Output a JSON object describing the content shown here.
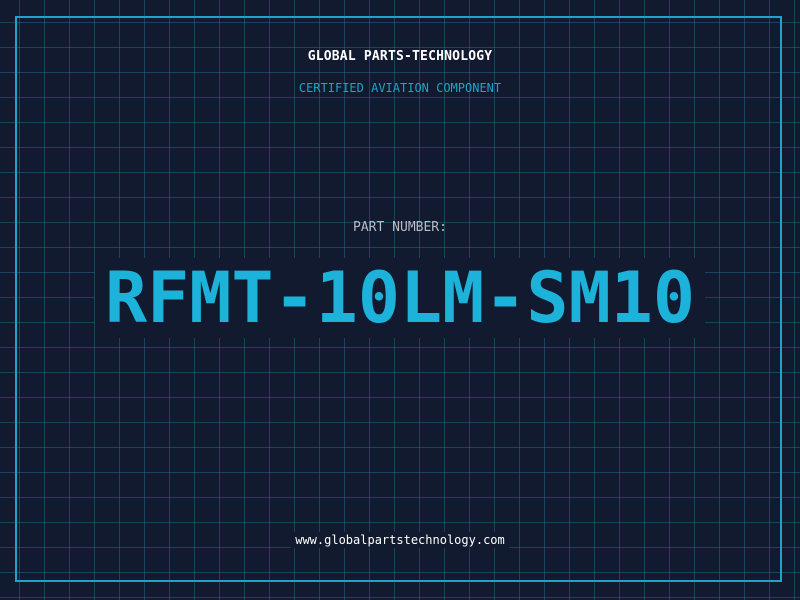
{
  "header": {
    "company_name": "GLOBAL PARTS-TECHNOLOGY",
    "subtitle": "CERTIFIED AVIATION COMPONENT"
  },
  "main": {
    "part_label": "PART NUMBER:",
    "part_number": "RFMT-10LM-SM10"
  },
  "footer": {
    "website": "www.globalpartstechnology.com"
  },
  "colors": {
    "background": "#111a2e",
    "accent": "#1fa3c9",
    "part_number": "#1cb2da",
    "grid": "#26788f"
  }
}
